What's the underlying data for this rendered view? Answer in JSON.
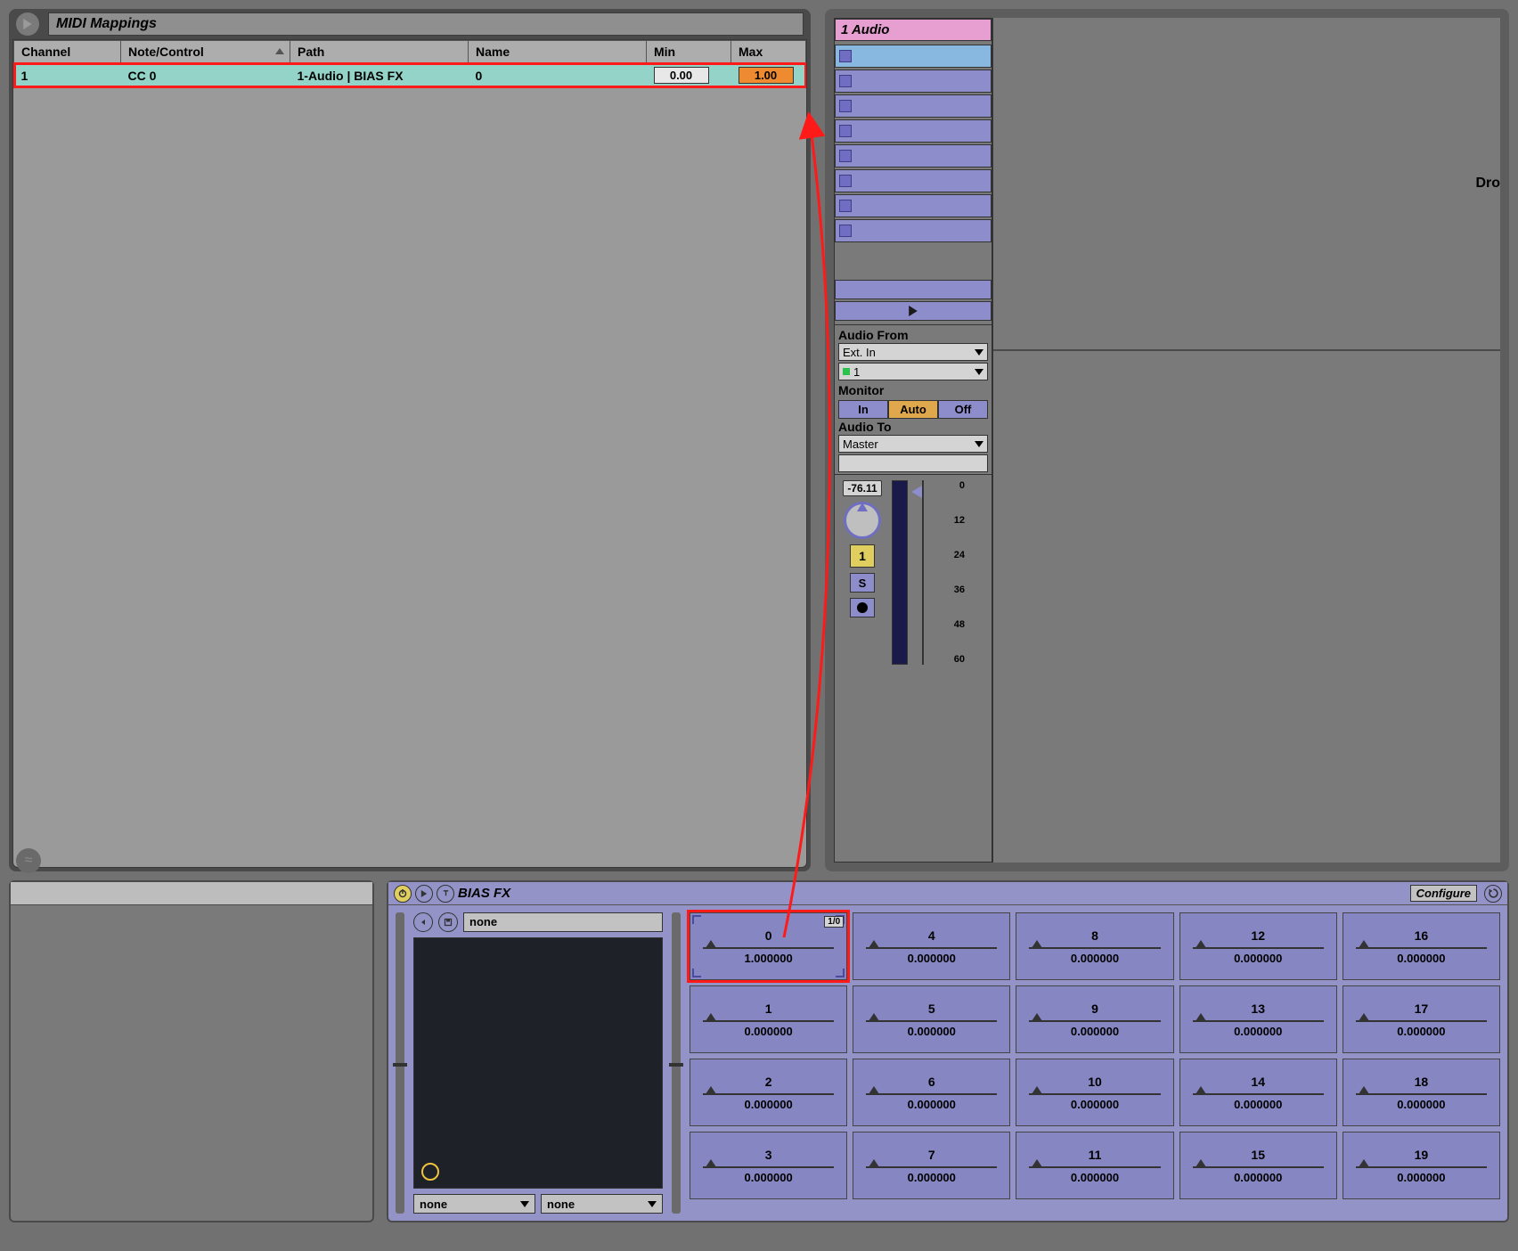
{
  "midi": {
    "title": "MIDI Mappings",
    "columns": [
      "Channel",
      "Note/Control",
      "Path",
      "Name",
      "Min",
      "Max"
    ],
    "row": {
      "channel": "1",
      "note": "CC 0",
      "path": "1-Audio | BIAS FX",
      "name": "0",
      "min": "0.00",
      "max": "1.00"
    }
  },
  "track": {
    "title": "1 Audio",
    "audio_from_label": "Audio From",
    "audio_from_value": "Ext. In",
    "audio_from_channel": "1",
    "monitor_label": "Monitor",
    "monitor_in": "In",
    "monitor_auto": "Auto",
    "monitor_off": "Off",
    "audio_to_label": "Audio To",
    "audio_to_value": "Master",
    "db": "-76.11",
    "activator": "1",
    "solo": "S",
    "scale": [
      "0",
      "12",
      "24",
      "36",
      "48",
      "60"
    ],
    "drop_text": "Dro"
  },
  "device": {
    "name": "BIAS FX",
    "configure": "Configure",
    "preset": "none",
    "bottom_select_a": "none",
    "bottom_select_b": "none",
    "param0_badge": "1/0",
    "params": [
      {
        "n": "0",
        "v": "1.000000",
        "tri": 0.02,
        "hi": true
      },
      {
        "n": "4",
        "v": "0.000000",
        "tri": 0.02
      },
      {
        "n": "8",
        "v": "0.000000",
        "tri": 0.02
      },
      {
        "n": "12",
        "v": "0.000000",
        "tri": 0.02
      },
      {
        "n": "16",
        "v": "0.000000",
        "tri": 0.02
      },
      {
        "n": "1",
        "v": "0.000000",
        "tri": 0.02
      },
      {
        "n": "5",
        "v": "0.000000",
        "tri": 0.02
      },
      {
        "n": "9",
        "v": "0.000000",
        "tri": 0.02
      },
      {
        "n": "13",
        "v": "0.000000",
        "tri": 0.02
      },
      {
        "n": "17",
        "v": "0.000000",
        "tri": 0.02
      },
      {
        "n": "2",
        "v": "0.000000",
        "tri": 0.02
      },
      {
        "n": "6",
        "v": "0.000000",
        "tri": 0.02
      },
      {
        "n": "10",
        "v": "0.000000",
        "tri": 0.02
      },
      {
        "n": "14",
        "v": "0.000000",
        "tri": 0.02
      },
      {
        "n": "18",
        "v": "0.000000",
        "tri": 0.02
      },
      {
        "n": "3",
        "v": "0.000000",
        "tri": 0.02
      },
      {
        "n": "7",
        "v": "0.000000",
        "tri": 0.02
      },
      {
        "n": "11",
        "v": "0.000000",
        "tri": 0.02
      },
      {
        "n": "15",
        "v": "0.000000",
        "tri": 0.02
      },
      {
        "n": "19",
        "v": "0.000000",
        "tri": 0.02
      }
    ]
  }
}
